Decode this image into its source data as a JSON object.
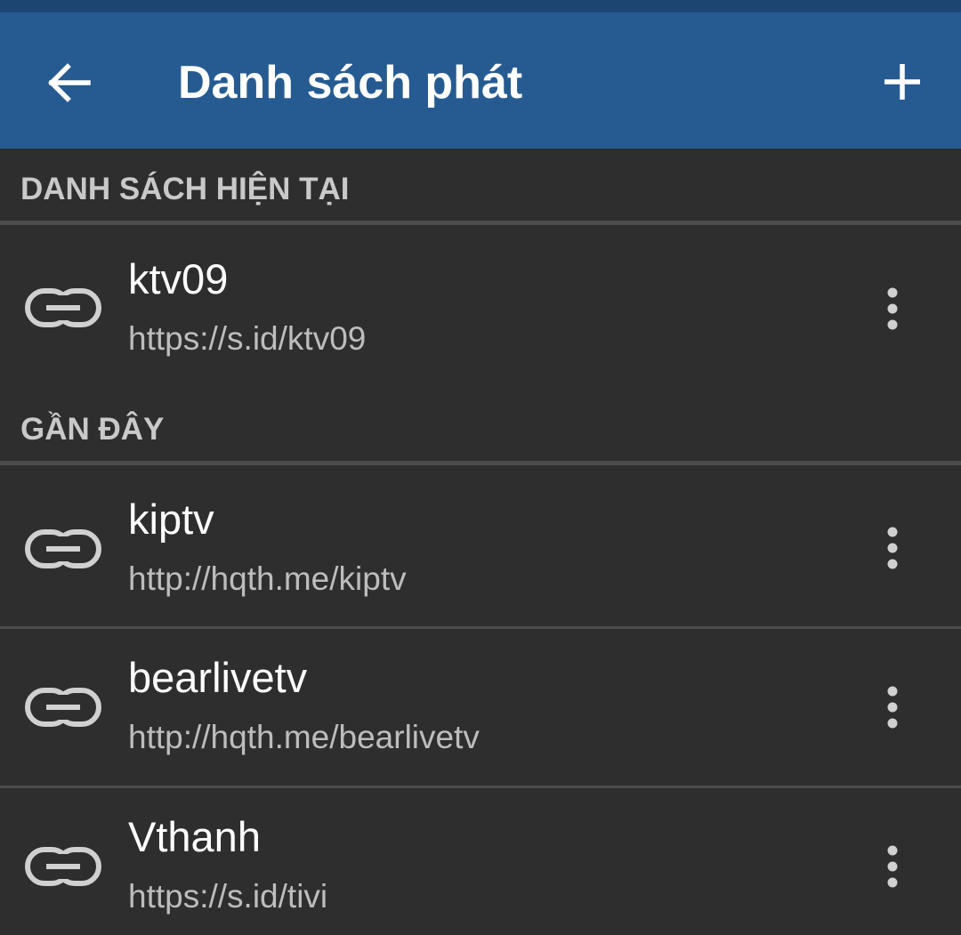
{
  "app_bar": {
    "back_icon": "arrow-back-icon",
    "title": "Danh sách phát",
    "add_icon": "plus-icon",
    "color": "#265b92"
  },
  "sections": {
    "current": {
      "header": "DANH SÁCH HIỆN TẠI"
    },
    "recent": {
      "header": "GẦN ĐÂY"
    }
  },
  "playlists": {
    "current": [
      {
        "name": "ktv09",
        "url": "https://s.id/ktv09",
        "icon": "link-icon",
        "menu_icon": "more-vert-icon"
      }
    ],
    "recent": [
      {
        "name": "kiptv",
        "url": "http://hqth.me/kiptv",
        "icon": "link-icon",
        "menu_icon": "more-vert-icon"
      },
      {
        "name": "bearlivetv",
        "url": "http://hqth.me/bearlivetv",
        "icon": "link-icon",
        "menu_icon": "more-vert-icon"
      },
      {
        "name": "Vthanh",
        "url": "https://s.id/tivi",
        "icon": "link-icon",
        "menu_icon": "more-vert-icon"
      }
    ]
  },
  "colors": {
    "background": "#2e2e2e",
    "header_text": "#c9c9c9",
    "title_text": "#ffffff",
    "url_text": "#bdbdbd",
    "icon": "#d0d0d0",
    "divider": "#4c4c4c"
  }
}
